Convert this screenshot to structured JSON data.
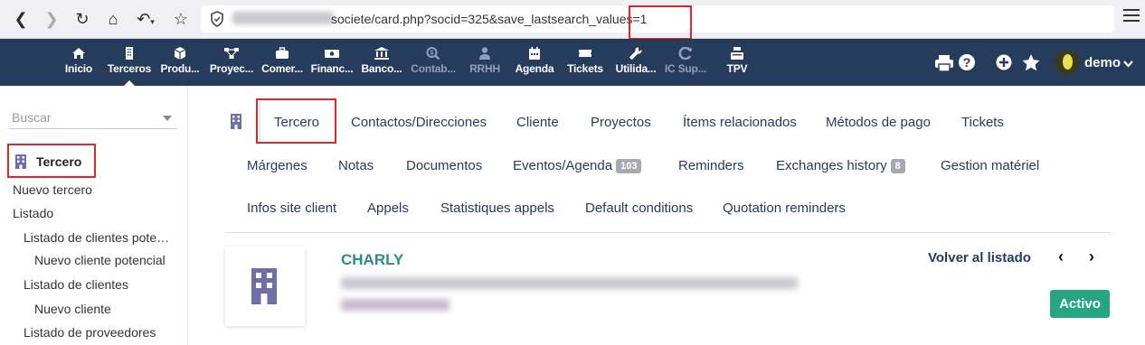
{
  "browser": {
    "url_path": "societe/card.php?socid=325&save_lastsearch_values=1",
    "icons": [
      "back-arrow-icon",
      "forward-arrow-icon",
      "reload-icon",
      "home-icon",
      "undo-icon",
      "star-icon",
      "shield-icon",
      "menu-icon"
    ]
  },
  "topnav": {
    "items": [
      {
        "label": "Inicio",
        "icon": "home-icon"
      },
      {
        "label": "Terceros",
        "icon": "building-icon"
      },
      {
        "label": "Produ...",
        "icon": "cube-icon"
      },
      {
        "label": "Proyec...",
        "icon": "project-icon"
      },
      {
        "label": "Comer...",
        "icon": "briefcase-icon"
      },
      {
        "label": "Financ...",
        "icon": "money-icon"
      },
      {
        "label": "Banco...",
        "icon": "bank-icon"
      },
      {
        "label": "Contab...",
        "icon": "search-dollar-icon"
      },
      {
        "label": "RRHH",
        "icon": "user-tie-icon"
      },
      {
        "label": "Agenda",
        "icon": "calendar-icon"
      },
      {
        "label": "Tickets",
        "icon": "ticket-icon"
      },
      {
        "label": "Utilida...",
        "icon": "wrench-icon"
      },
      {
        "label": "IC Sup...",
        "icon": "support-icon"
      },
      {
        "label": "TPV",
        "icon": "cash-register-icon"
      }
    ],
    "user": "demo",
    "right_icons": [
      "print-icon",
      "help-icon",
      "plus-icon",
      "star-icon",
      "avatar",
      "chevron-down-icon"
    ]
  },
  "sidebar": {
    "search_placeholder": "Buscar",
    "title": "Tercero",
    "links": [
      "Nuevo tercero",
      "Listado",
      "Listado de clientes pote…",
      "Nuevo cliente potencial",
      "Listado de clientes",
      "Nuevo cliente",
      "Listado de proveedores"
    ]
  },
  "tabs": {
    "row1": [
      "Tercero",
      "Contactos/Direcciones",
      "Cliente",
      "Proyectos",
      "Ítems relacionados",
      "Métodos de pago",
      "Tickets"
    ],
    "row2": [
      "Márgenes",
      "Notas",
      "Documentos",
      "Eventos/Agenda",
      "Reminders",
      "Exchanges history",
      "Gestion matériel"
    ],
    "row3": [
      "Infos site client",
      "Appels",
      "Statistiques appels",
      "Default conditions",
      "Quotation reminders"
    ],
    "events_count": "103",
    "exchanges_count": "8"
  },
  "card": {
    "company_name": "CHARLY",
    "back_link": "Volver al listado",
    "status": "Activo"
  },
  "colors": {
    "topnav_bg": "#263c5c",
    "company_name": "#2b8c8e",
    "status_badge": "#25a580",
    "highlight": "#e0242a"
  }
}
